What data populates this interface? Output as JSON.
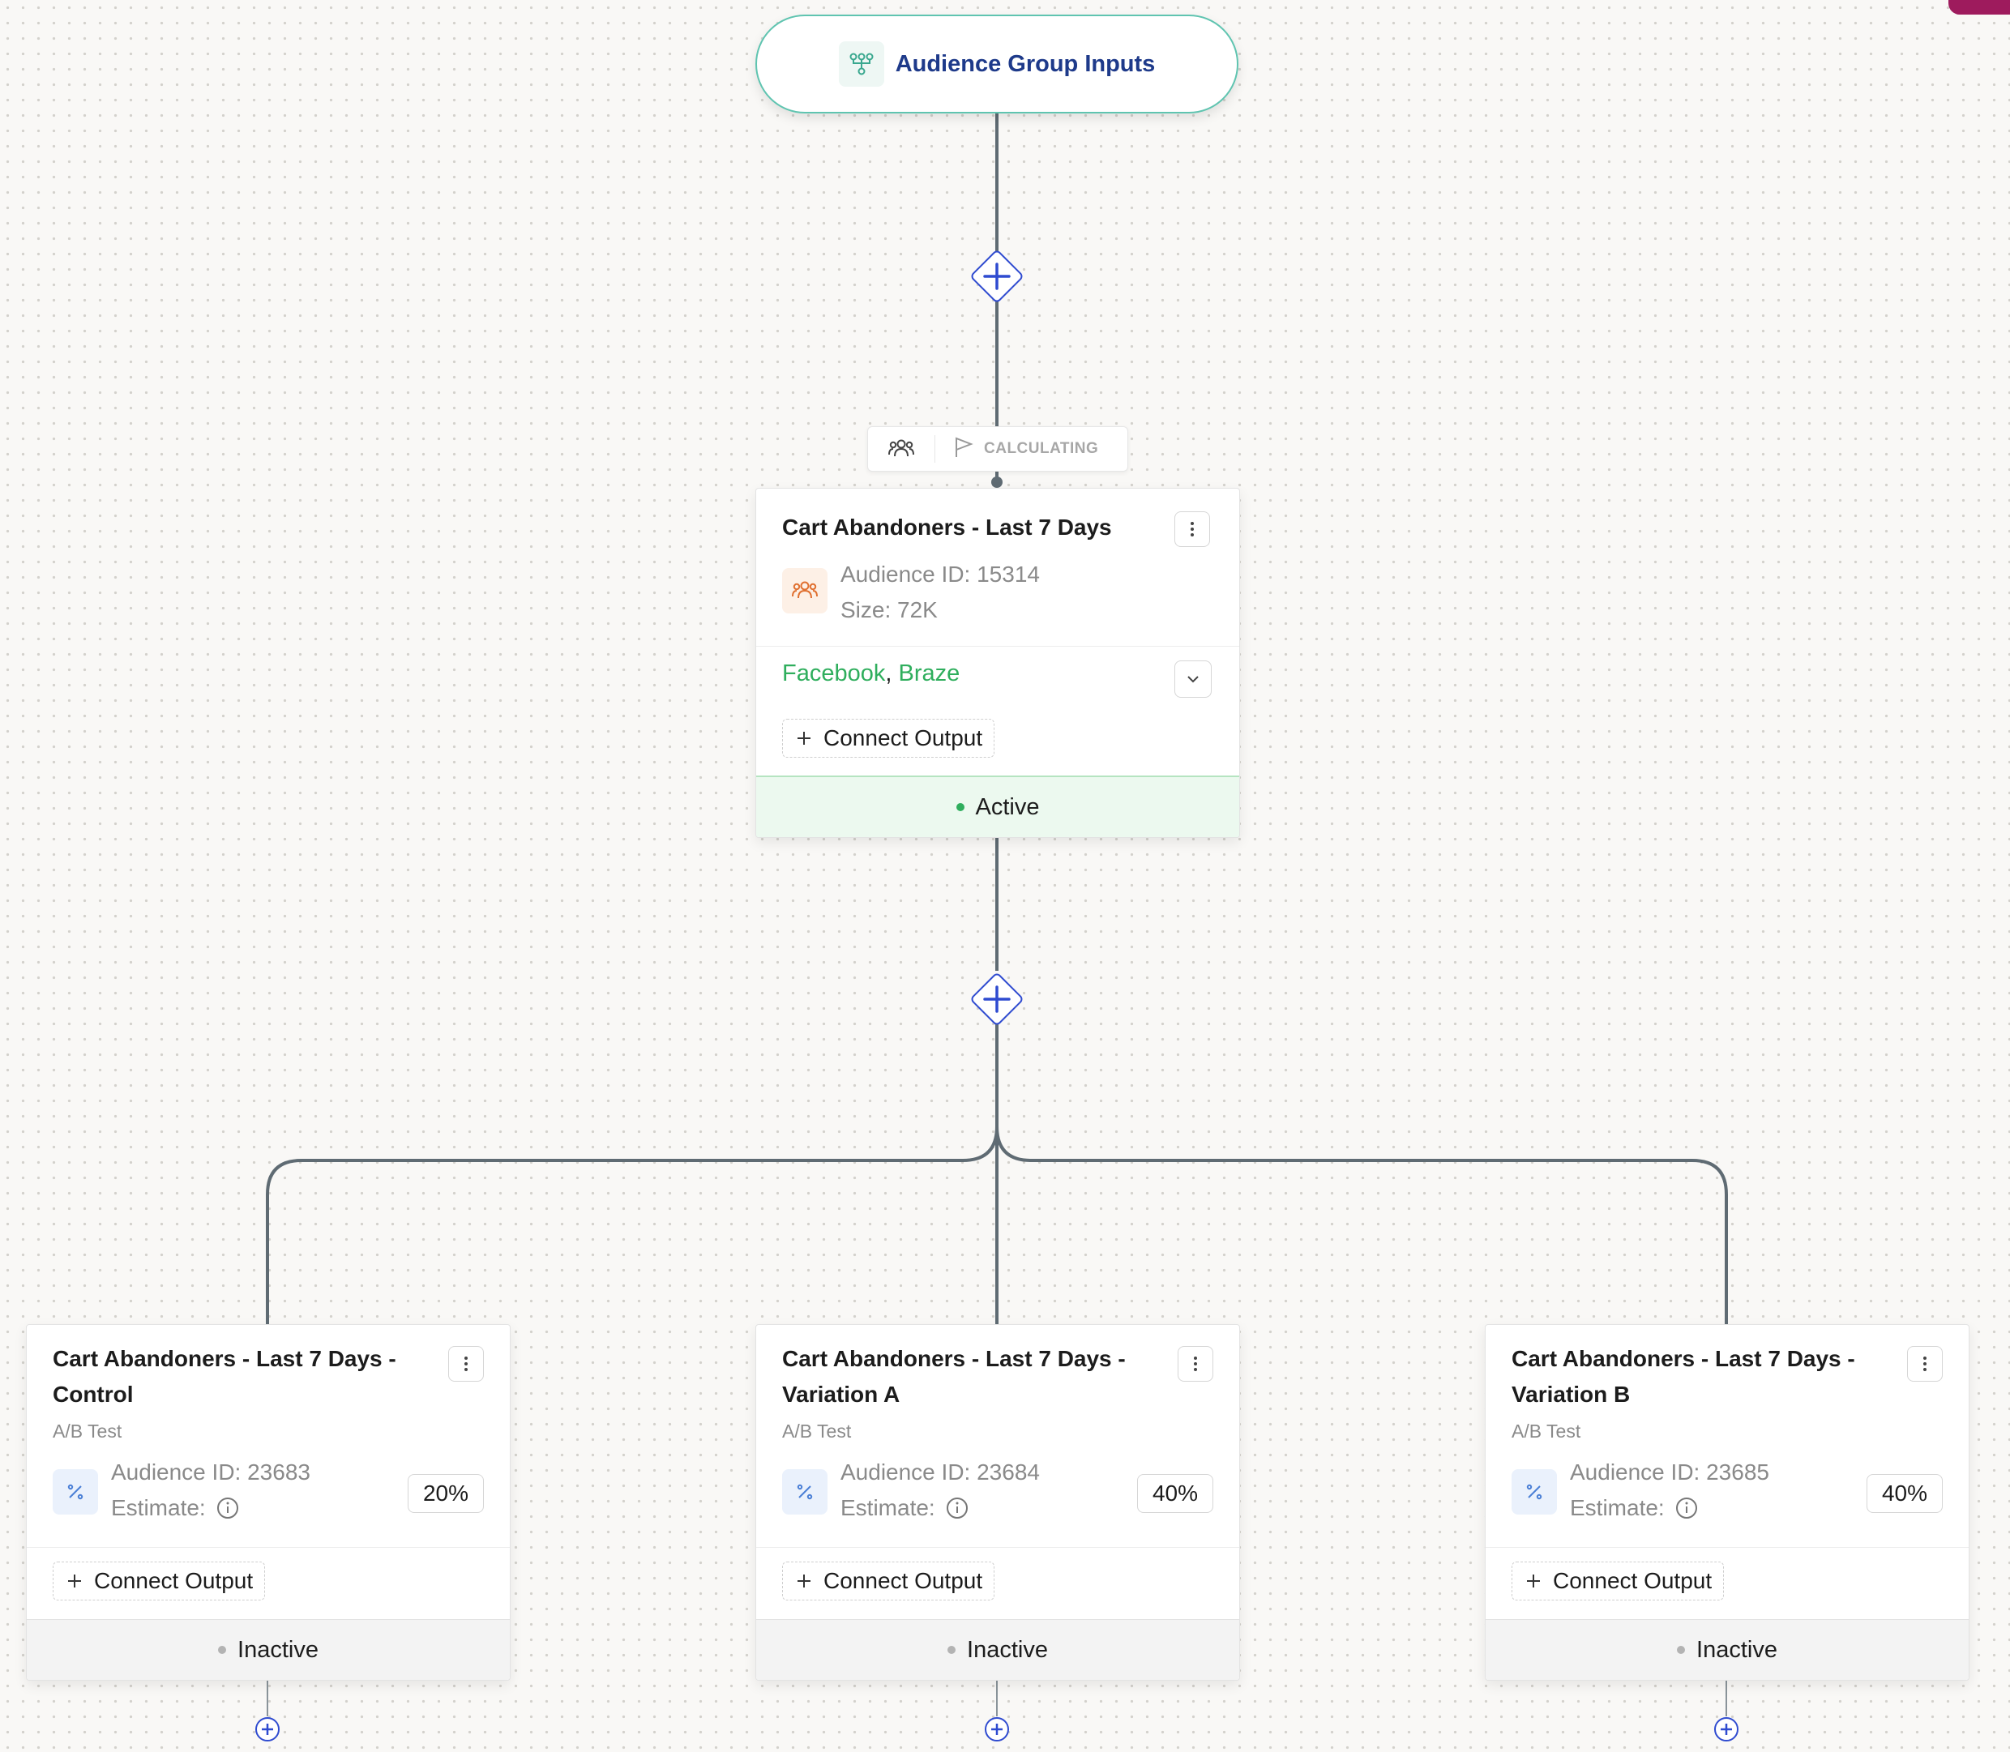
{
  "root": {
    "title": "Audience Group Inputs",
    "icon": "hierarchy-icon"
  },
  "status_chip": {
    "label": "CALCULATING",
    "icons": [
      "users-icon",
      "flag-icon"
    ]
  },
  "main_card": {
    "title": "Cart Abandoners - Last 7 Days",
    "audience_id": "Audience ID: 15314",
    "size": "Size: 72K",
    "destinations": [
      "Facebook",
      "Braze"
    ],
    "separator": ",",
    "connect_label": "Connect Output",
    "status": "Active",
    "accent_color": "#2fae5d"
  },
  "variants": [
    {
      "title_line1": "Cart Abandoners - Last 7 Days -",
      "title_line2": "Control",
      "subtitle": "A/B Test",
      "audience_id": "Audience ID: 23683",
      "estimate_label": "Estimate:",
      "percent": "20%",
      "connect_label": "Connect Output",
      "status": "Inactive"
    },
    {
      "title_line1": "Cart Abandoners - Last 7 Days -",
      "title_line2": "Variation A",
      "subtitle": "A/B Test",
      "audience_id": "Audience ID: 23684",
      "estimate_label": "Estimate:",
      "percent": "40%",
      "connect_label": "Connect Output",
      "status": "Inactive"
    },
    {
      "title_line1": "Cart Abandoners - Last 7 Days -",
      "title_line2": "Variation B",
      "subtitle": "A/B Test",
      "audience_id": "Audience ID: 23685",
      "estimate_label": "Estimate:",
      "percent": "40%",
      "connect_label": "Connect Output",
      "status": "Inactive"
    }
  ],
  "colors": {
    "edge": "#5f6b73",
    "add_node": "#2f4bd0",
    "root_border": "#5fc4b0",
    "title_blue": "#1e3a8a"
  }
}
